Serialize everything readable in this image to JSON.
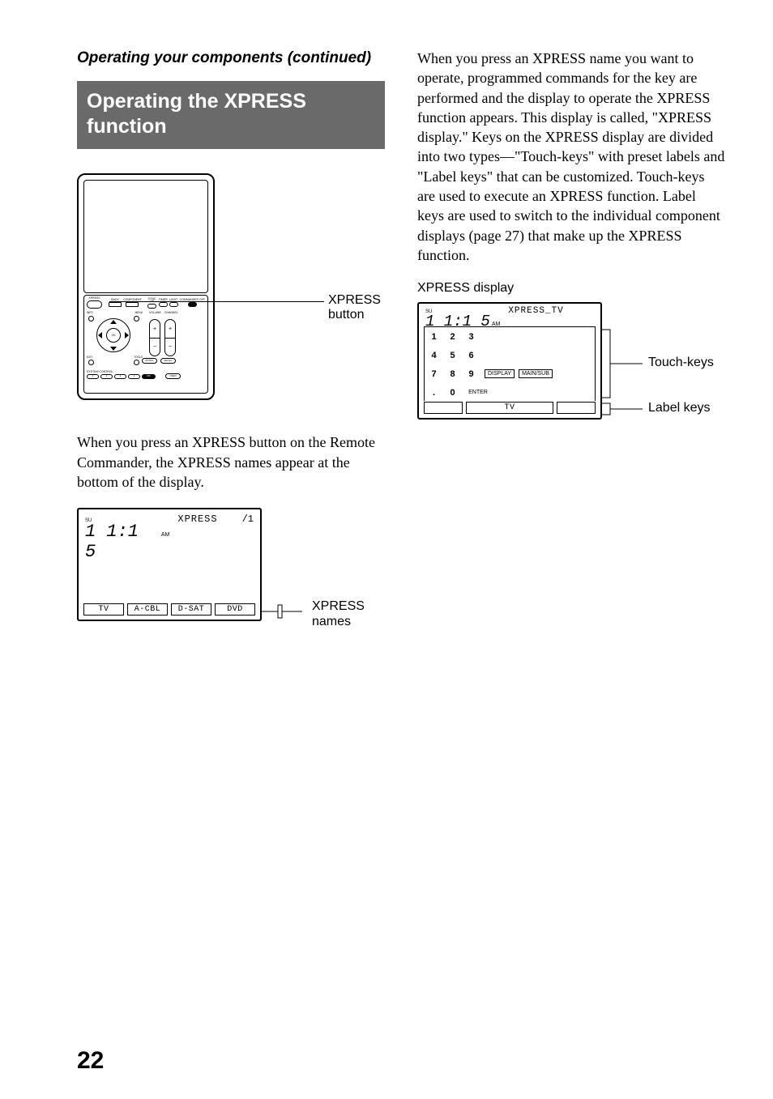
{
  "header": {
    "continued": "Operating your components (continued)"
  },
  "section_title": "Operating the XPRESS function",
  "remote_figure": {
    "xpress_button_label": "XPRESS button",
    "buttons": {
      "xpress": "XPRESS",
      "back": "BACK",
      "component": "COMPONENT",
      "syncup": "SYNC UP",
      "timer": "TIMER",
      "light": "LIGHT",
      "commander_off": "COMMANDER OFF",
      "info": "INFO",
      "menu": "MENU",
      "exit": "EXIT",
      "tools": "TOOLS",
      "ok": "OK",
      "volume": "VOLUME",
      "channel": "CHANNEL",
      "muting": "MUTING",
      "recall": "RECALL",
      "system_control": "SYSTEM CONTROL",
      "sys": [
        "1",
        "2",
        "3",
        "4",
        "OFF"
      ],
      "check": "CHECK"
    }
  },
  "para1": "When you press an XPRESS button on the Remote Commander, the XPRESS names appear at the bottom of the display.",
  "lcd1": {
    "day": "SU",
    "time": "1 1:1 5",
    "ampm": "AM",
    "title": "XPRESS",
    "page": "/1",
    "tabs": [
      "TV",
      "A-CBL",
      "D-SAT",
      "DVD"
    ],
    "names_label": "XPRESS names"
  },
  "right_para": "When you press an XPRESS name you want to operate, programmed commands for the key are performed and the display to operate the XPRESS function appears. This display is called, \"XPRESS display.\" Keys on the XPRESS display are divided into two types—\"Touch-keys\" with preset labels and \"Label keys\" that can be customized. Touch-keys are used to execute an XPRESS function. Label keys are used to switch to the individual component displays (page 27) that make up the XPRESS function.",
  "lcd2": {
    "caption": "XPRESS display",
    "day": "SU",
    "time": "1 1:1 5",
    "ampm": "AM",
    "title": "XPRESS_TV",
    "keypad": [
      [
        "1",
        "2",
        "3"
      ],
      [
        "4",
        "5",
        "6"
      ],
      [
        "7",
        "8",
        "9"
      ],
      [
        ".",
        "0",
        "ENTER"
      ]
    ],
    "buttons": [
      "DISPLAY",
      "MAIN/SUB"
    ],
    "label_tab": "TV",
    "touch_keys_label": "Touch-keys",
    "label_keys_label": "Label keys"
  },
  "page_number": "22"
}
